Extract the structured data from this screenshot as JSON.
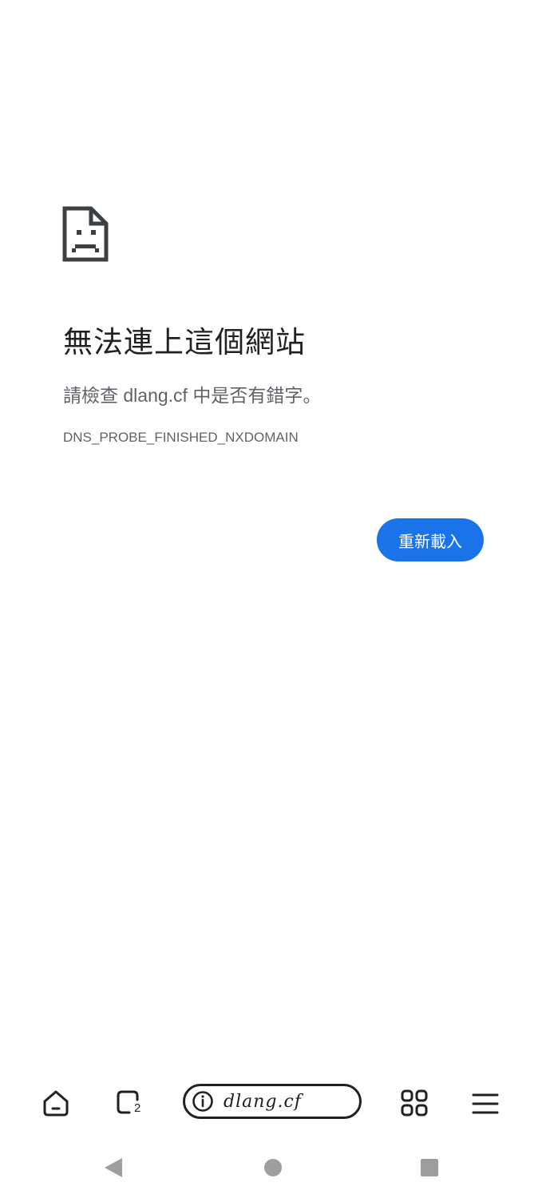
{
  "error": {
    "icon": "sad-page-icon",
    "title": "無法連上這個網站",
    "message": "請檢查 dlang.cf 中是否有錯字。",
    "code": "DNS_PROBE_FINISHED_NXDOMAIN",
    "reload_label": "重新載入",
    "reload_color": "#1a73e8"
  },
  "toolbar": {
    "home_icon": "home-icon",
    "tabs_icon": "tabs-icon",
    "tab_count": "2",
    "info_icon": "info-icon",
    "url": "dlang.cf",
    "grid_icon": "grid-icon",
    "menu_icon": "menu-icon"
  },
  "navbar": {
    "back_icon": "back-triangle-icon",
    "home_icon": "home-circle-icon",
    "recents_icon": "recents-square-icon"
  }
}
